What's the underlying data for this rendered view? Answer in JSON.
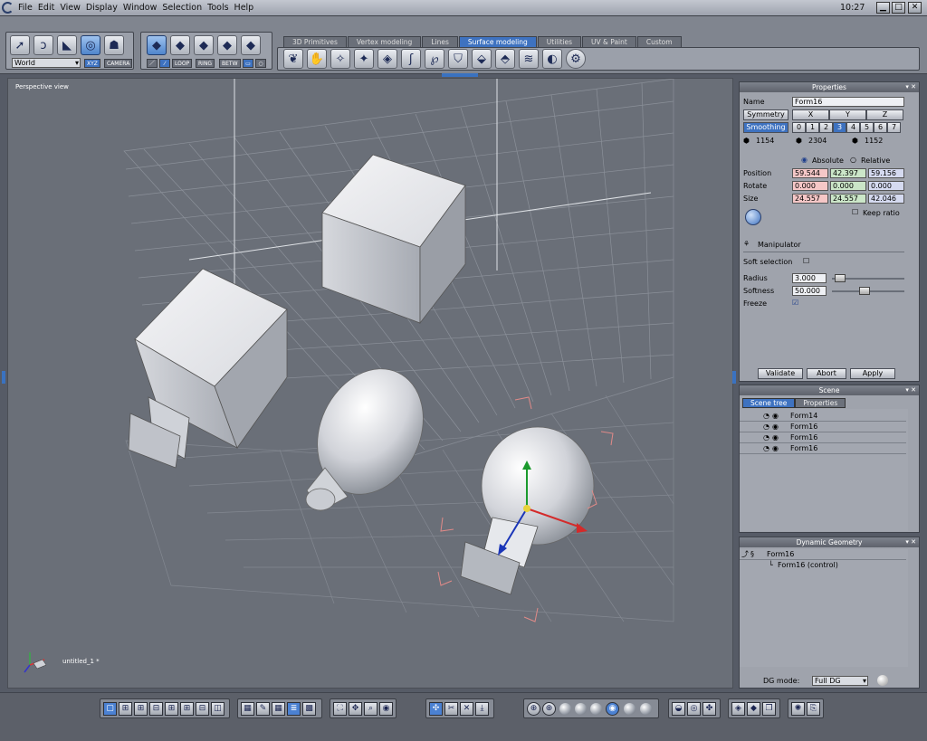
{
  "menubar": {
    "items": [
      "File",
      "Edit",
      "View",
      "Display",
      "Window",
      "Selection",
      "Tools",
      "Help"
    ],
    "clock": "10:27"
  },
  "toolbar": {
    "space_select": "World",
    "xyz_label": "XYZ",
    "camera_label": "CAMERA",
    "mode_labels": [
      "LOOP",
      "RING",
      "BETW"
    ],
    "tabs": [
      "3D Primitives",
      "Vertex modeling",
      "Lines",
      "Surface modeling",
      "Utilities",
      "UV & Paint",
      "Custom"
    ],
    "active_tab": "Surface modeling"
  },
  "viewport": {
    "label": "Perspective view",
    "document": "untitled_1 *"
  },
  "properties": {
    "title": "Properties",
    "name_label": "Name",
    "name_value": "Form16",
    "symmetry_label": "Symmetry",
    "sym_axes": [
      "X",
      "Y",
      "Z"
    ],
    "smoothing_label": "Smoothing",
    "smoothing_levels": [
      "0",
      "1",
      "2",
      "3",
      "4",
      "5",
      "6",
      "7"
    ],
    "smoothing_active": "3",
    "counts": [
      "1154",
      "2304",
      "1152"
    ],
    "absolute_label": "Absolute",
    "relative_label": "Relative",
    "position_label": "Position",
    "position": [
      "59.544",
      "42.397",
      "59.156"
    ],
    "rotate_label": "Rotate",
    "rotate": [
      "0.000",
      "0.000",
      "0.000"
    ],
    "size_label": "Size",
    "size": [
      "24.557",
      "24.557",
      "42.046"
    ],
    "keep_ratio_label": "Keep ratio",
    "manipulator_label": "Manipulator",
    "soft_selection_label": "Soft selection",
    "radius_label": "Radius",
    "radius_value": "3.000",
    "softness_label": "Softness",
    "softness_value": "50.000",
    "freeze_label": "Freeze",
    "validate_label": "Validate",
    "abort_label": "Abort",
    "apply_label": "Apply"
  },
  "scene": {
    "title": "Scene",
    "tabs": [
      "Scene tree",
      "Properties"
    ],
    "items": [
      "Form14",
      "Form16",
      "Form16",
      "Form16"
    ],
    "selected_index": 3
  },
  "dyngeo": {
    "title": "Dynamic Geometry",
    "items": [
      "Form16",
      "Form16 (control)"
    ],
    "dg_mode_label": "DG mode:",
    "dg_mode_value": "Full DG"
  },
  "colors": {
    "accent": "#3e72c0",
    "selection": "#3e7fd9",
    "field_red": "#f5c7c7",
    "field_green": "#cbe6c8",
    "field_blue": "#d5daf0"
  }
}
